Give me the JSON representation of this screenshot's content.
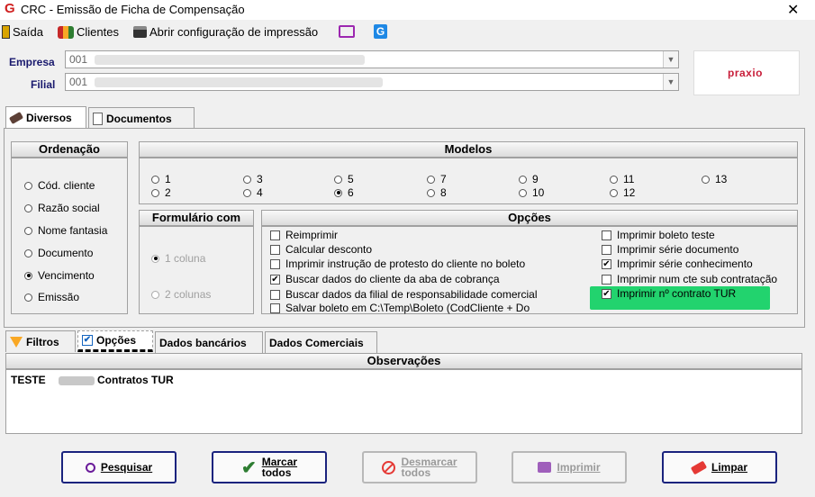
{
  "window": {
    "title": "CRC - Emissão de Ficha de Compensação",
    "close": "✕"
  },
  "toolbar": {
    "saida": "Saída",
    "clientes": "Clientes",
    "config": "Abrir configuração de impressão"
  },
  "empresa": {
    "label": "Empresa",
    "value": "001"
  },
  "filial": {
    "label": "Filial",
    "value": "001"
  },
  "logo_text": "praxio",
  "top_tabs": [
    {
      "label": "Diversos"
    },
    {
      "label": "Documentos"
    }
  ],
  "ordenacao": {
    "title": "Ordenação",
    "options": [
      "Cód. cliente",
      "Razão social",
      "Nome fantasia",
      "Documento",
      "Vencimento",
      "Emissão"
    ],
    "selected": "Vencimento"
  },
  "modelos": {
    "title": "Modelos",
    "options": [
      "1",
      "2",
      "3",
      "4",
      "5",
      "6",
      "7",
      "8",
      "9",
      "10",
      "11",
      "12",
      "13"
    ],
    "selected": "6"
  },
  "formulario": {
    "title": "Formulário com",
    "options": [
      "1 coluna",
      "2 colunas"
    ],
    "selected": "1 coluna"
  },
  "opcoes": {
    "title": "Opções",
    "left": [
      {
        "label": "Reimprimir",
        "checked": false
      },
      {
        "label": "Calcular desconto",
        "checked": false
      },
      {
        "label": "Imprimir instrução de protesto do cliente no boleto",
        "checked": false
      },
      {
        "label": "Buscar dados do cliente da aba de cobrança",
        "checked": true
      },
      {
        "label": "Buscar dados da filial de responsabilidade comercial",
        "checked": false
      },
      {
        "label": "Salvar boleto em C:\\Temp\\Boleto (CodCliente + Do",
        "checked": false
      }
    ],
    "right": [
      {
        "label": "Imprimir boleto teste",
        "checked": false
      },
      {
        "label": "Imprimir série documento",
        "checked": false
      },
      {
        "label": "Imprimir série conhecimento",
        "checked": true
      },
      {
        "label": "Imprimir num cte sub contratação",
        "checked": false
      },
      {
        "label": "Imprimir nº contrato TUR",
        "checked": true
      }
    ],
    "highlight_color": "#22d36e"
  },
  "bottom_tabs": [
    {
      "label": "Filtros"
    },
    {
      "label": "Opções"
    },
    {
      "label": "Dados bancários"
    },
    {
      "label": "Dados Comerciais"
    }
  ],
  "observacoes": {
    "title": "Observações",
    "text_a": "TESTE",
    "text_b": "Contratos TUR"
  },
  "buttons": {
    "pesquisar": "Pesquisar",
    "marcar_1": "Marcar",
    "marcar_2": "todos",
    "desmarcar_1": "Desmarcar",
    "desmarcar_2": "todos",
    "imprimir": "Imprimir",
    "limpar": "Limpar"
  },
  "icons": [
    "app-logo-icon",
    "exit-door-icon",
    "clients-icon",
    "printer-icon",
    "monitor-icon",
    "app-g-icon",
    "brush-icon",
    "document-icon",
    "filter-icon",
    "search-icon",
    "check-icon",
    "no-entry-icon",
    "eraser-icon"
  ]
}
